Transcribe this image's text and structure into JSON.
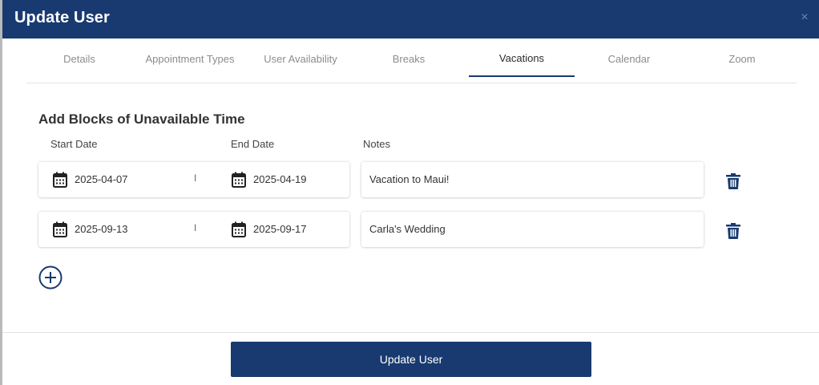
{
  "modal": {
    "title": "Update User",
    "close_glyph": "×"
  },
  "tabs": [
    {
      "label": "Details",
      "active": false
    },
    {
      "label": "Appointment Types",
      "active": false
    },
    {
      "label": "User Availability",
      "active": false
    },
    {
      "label": "Breaks",
      "active": false
    },
    {
      "label": "Vacations",
      "active": true
    },
    {
      "label": "Calendar",
      "active": false
    },
    {
      "label": "Zoom",
      "active": false
    }
  ],
  "section": {
    "title": "Add Blocks of Unavailable Time",
    "columns": {
      "start": "Start Date",
      "end": "End Date",
      "notes": "Notes"
    }
  },
  "vacations": [
    {
      "start": "2025-04-07",
      "separator": "I",
      "end": "2025-04-19",
      "notes": "Vacation to Maui!"
    },
    {
      "start": "2025-09-13",
      "separator": "I",
      "end": "2025-09-17",
      "notes": "Carla's Wedding"
    }
  ],
  "icons": {
    "calendar": "calendar-icon",
    "trash": "trash-icon",
    "add": "plus-circle-icon",
    "close": "close-icon"
  },
  "footer": {
    "submit_label": "Update User"
  },
  "colors": {
    "primary": "#183a70",
    "active_tab_text": "#2b2b2b",
    "inactive_tab_text": "#8c8c8c"
  }
}
